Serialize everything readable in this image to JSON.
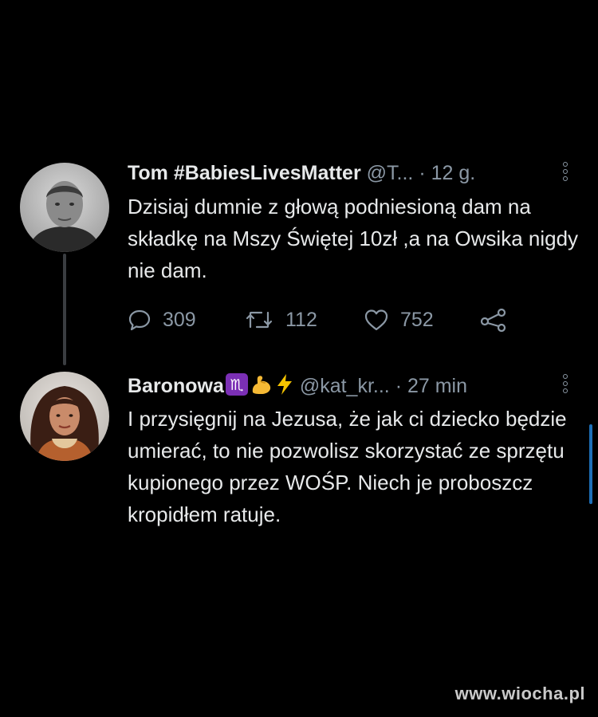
{
  "tweets": [
    {
      "display_name": "Tom #BabiesLivesMatter",
      "handle": "@T...",
      "separator": "·",
      "time": "12 g.",
      "body": "Dzisiaj dumnie z głową podniesioną dam na składkę na Mszy Świętej 10zł ,a na Owsika nigdy nie dam.",
      "avatar": "user-avatar-photo",
      "actions": {
        "replies": "309",
        "retweets": "112",
        "likes": "752"
      }
    },
    {
      "display_name": "Baronowa",
      "name_emojis": [
        "scorpio-sign",
        "flexed-biceps",
        "lightning-bolt"
      ],
      "handle": "@kat_kr...",
      "separator": "·",
      "time": "27 min",
      "body": "I przysięgnij na Jezusa, że jak ci dziecko będzie umierać, to nie pozwolisz skorzystać ze sprzętu kupionego przez WOŚP. Niech je proboszcz kropidłem ratuje.",
      "avatar": "user-avatar-photo"
    }
  ],
  "icons": {
    "reply": "reply-icon",
    "retweet": "retweet-icon",
    "like": "heart-icon",
    "share": "share-icon",
    "more": "more-vertical-icon"
  },
  "colors": {
    "background": "#000000",
    "text": "#e7e9ea",
    "secondary": "#8b98a5",
    "scorpio_badge": "#7b2fb5",
    "bolt": "#f5c400",
    "scroll": "#1d6fb8"
  },
  "watermark": "www.wiocha.pl"
}
